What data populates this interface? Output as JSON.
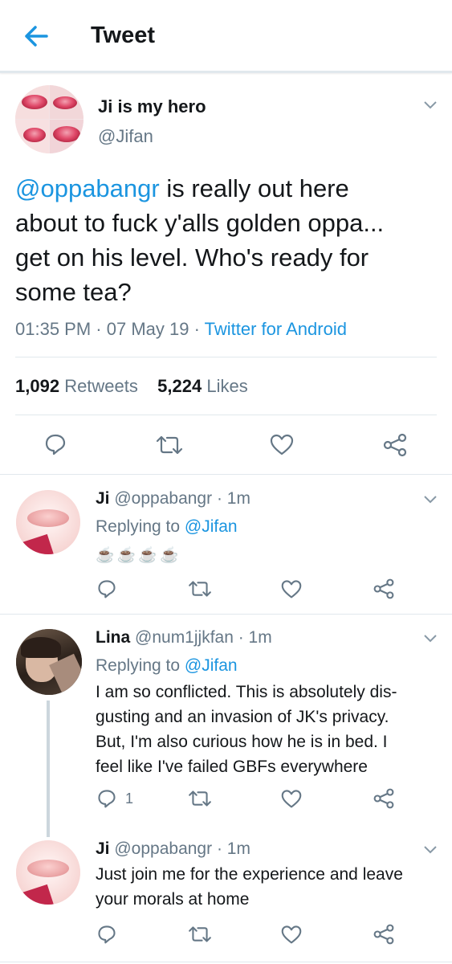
{
  "header": {
    "title": "Tweet"
  },
  "main_tweet": {
    "author_name": "Ji is my hero",
    "author_handle": "@Jifan",
    "text_mention": "@oppabangr",
    "text_line1_rest": " is really out here",
    "text_line2": "about to fuck y'alls golden oppa...",
    "text_line3": "get on his level. Who's ready for",
    "text_line4": "some tea?",
    "time": "01:35 PM",
    "date": "07 May 19",
    "sep": "·",
    "client": "Twitter for Android",
    "retweets_count": "1,092",
    "retweets_label": "Retweets",
    "likes_count": "5,224",
    "likes_label": "Likes"
  },
  "replies": [
    {
      "name": "Ji",
      "handle": "@oppabangr",
      "time": "· 1m",
      "replying_label": "Replying to",
      "replying_to": "@Jifan",
      "text": "☕☕☕☕"
    },
    {
      "name": "Lina",
      "handle": "@num1jjkfan",
      "time": "· 1m",
      "replying_label": "Replying to",
      "replying_to": "@Jifan",
      "lines": [
        "I am so conflicted. This is absolutely dis-",
        "gusting and an invasion of JK's privacy.",
        "But, I'm also curious how he is in bed. I",
        "feel like I've failed GBFs everywhere"
      ],
      "reply_count": "1"
    },
    {
      "name": "Ji",
      "handle": "@oppabangr",
      "time": "· 1m",
      "lines": [
        "Just join me for the experience and leave",
        "your morals at home"
      ]
    }
  ],
  "colors": {
    "accent": "#1b95e0",
    "muted": "#657786",
    "divider": "#e1e8ed"
  },
  "icons": [
    "back-arrow-icon",
    "chevron-down-icon",
    "reply-icon",
    "retweet-icon",
    "like-icon",
    "share-icon"
  ]
}
